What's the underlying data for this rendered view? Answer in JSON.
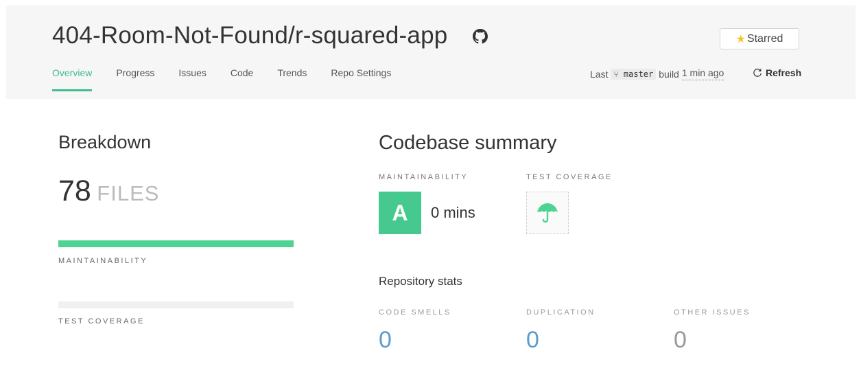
{
  "header": {
    "repo_title": "404-Room-Not-Found/r-squared-app",
    "star_label": "Starred",
    "tabs": [
      {
        "label": "Overview",
        "active": true
      },
      {
        "label": "Progress",
        "active": false
      },
      {
        "label": "Issues",
        "active": false
      },
      {
        "label": "Code",
        "active": false
      },
      {
        "label": "Trends",
        "active": false
      },
      {
        "label": "Repo Settings",
        "active": false
      }
    ],
    "build": {
      "prefix": "Last",
      "branch": "master",
      "middle": "build",
      "time": "1 min ago"
    },
    "refresh_label": "Refresh"
  },
  "breakdown": {
    "title": "Breakdown",
    "files_count": "78",
    "files_label": "FILES",
    "maintainability_label": "MAINTAINABILITY",
    "maintainability_fraction": 1.0,
    "test_coverage_label": "TEST COVERAGE",
    "test_coverage_fraction": 0
  },
  "summary": {
    "title": "Codebase summary",
    "maintainability_label": "MAINTAINABILITY",
    "grade": "A",
    "grade_time": "0 mins",
    "test_coverage_label": "TEST COVERAGE",
    "test_coverage_icon": "umbrella-icon"
  },
  "stats": {
    "title": "Repository stats",
    "items": [
      {
        "label": "CODE SMELLS",
        "value": "0"
      },
      {
        "label": "DUPLICATION",
        "value": "0"
      },
      {
        "label": "OTHER ISSUES",
        "value": "0"
      }
    ]
  },
  "colors": {
    "accent_green": "#3dbd8a",
    "grade_green": "#45c98f",
    "bar_green": "#4fd392",
    "stat_blue": "#5b9ccb",
    "star_yellow": "#f5c518"
  }
}
